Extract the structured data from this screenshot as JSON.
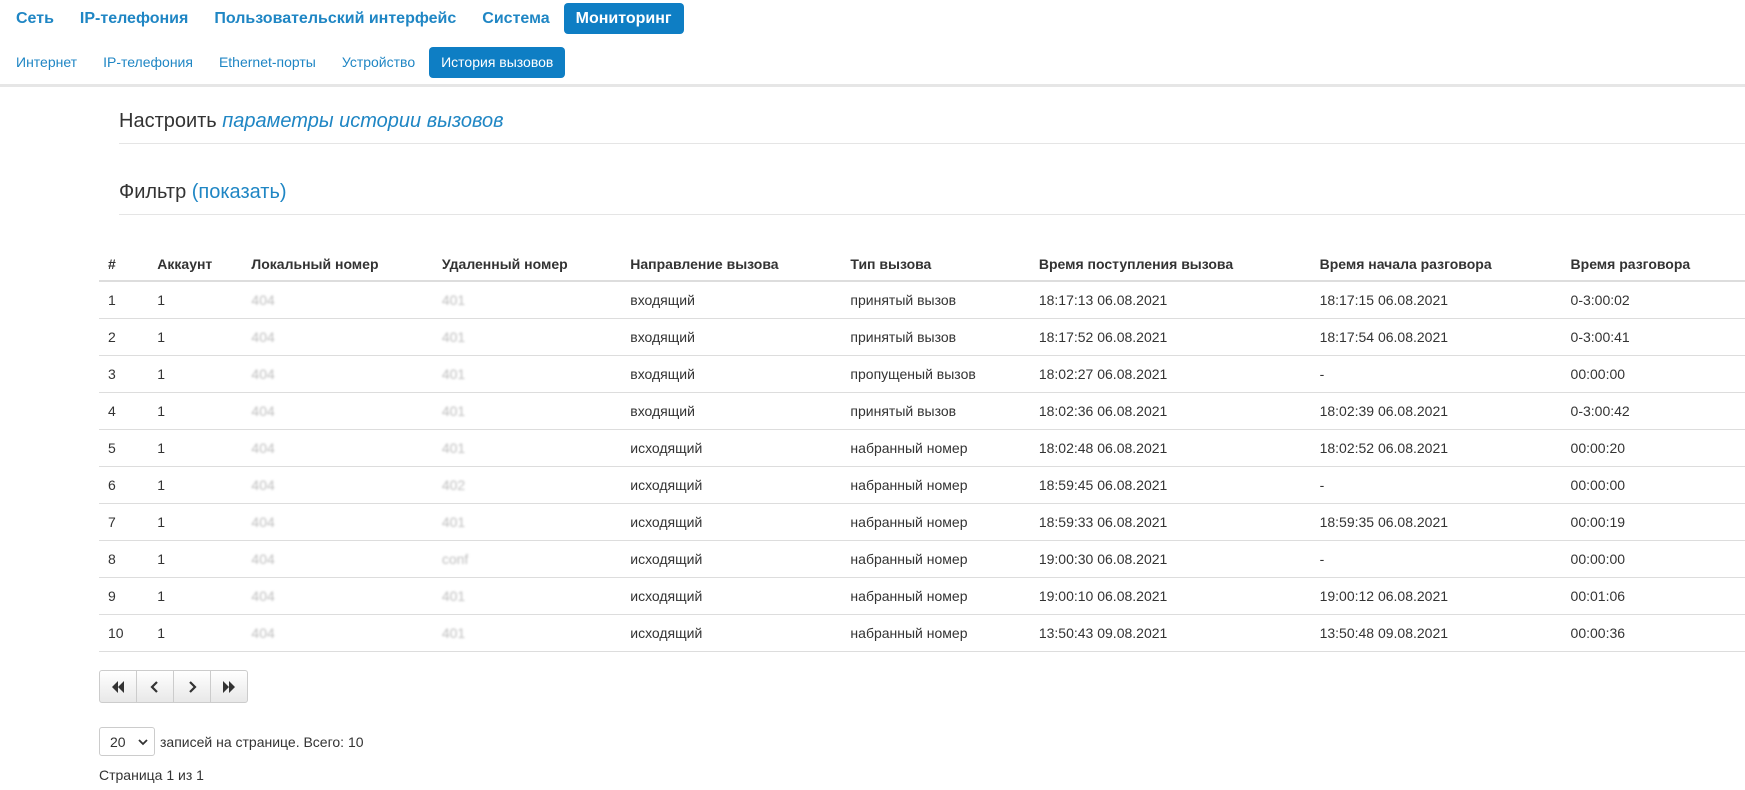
{
  "top_nav": [
    {
      "label": "Сеть",
      "active": false
    },
    {
      "label": "IP-телефония",
      "active": false
    },
    {
      "label": "Пользовательский интерфейс",
      "active": false
    },
    {
      "label": "Система",
      "active": false
    },
    {
      "label": "Мониторинг",
      "active": true
    }
  ],
  "sub_nav": [
    {
      "label": "Интернет",
      "active": false
    },
    {
      "label": "IP-телефония",
      "active": false
    },
    {
      "label": "Ethernet-порты",
      "active": false
    },
    {
      "label": "Устройство",
      "active": false
    },
    {
      "label": "История вызовов",
      "active": true
    }
  ],
  "settings": {
    "prefix": "Настроить ",
    "link": "параметры истории вызовов"
  },
  "filter": {
    "prefix": "Фильтр ",
    "link": "(показать)"
  },
  "table": {
    "headers": [
      "#",
      "Аккаунт",
      "Локальный номер",
      "Удаленный номер",
      "Направление вызова",
      "Тип вызова",
      "Время поступления вызова",
      "Время начала разговора",
      "Время разговора"
    ],
    "rows": [
      [
        "1",
        "1",
        "404",
        "401",
        "входящий",
        "принятый вызов",
        "18:17:13 06.08.2021",
        "18:17:15 06.08.2021",
        "0-3:00:02"
      ],
      [
        "2",
        "1",
        "404",
        "401",
        "входящий",
        "принятый вызов",
        "18:17:52 06.08.2021",
        "18:17:54 06.08.2021",
        "0-3:00:41"
      ],
      [
        "3",
        "1",
        "404",
        "401",
        "входящий",
        "пропущеный вызов",
        "18:02:27 06.08.2021",
        "-",
        "00:00:00"
      ],
      [
        "4",
        "1",
        "404",
        "401",
        "входящий",
        "принятый вызов",
        "18:02:36 06.08.2021",
        "18:02:39 06.08.2021",
        "0-3:00:42"
      ],
      [
        "5",
        "1",
        "404",
        "401",
        "исходящий",
        "набранный номер",
        "18:02:48 06.08.2021",
        "18:02:52 06.08.2021",
        "00:00:20"
      ],
      [
        "6",
        "1",
        "404",
        "402",
        "исходящий",
        "набранный номер",
        "18:59:45 06.08.2021",
        "-",
        "00:00:00"
      ],
      [
        "7",
        "1",
        "404",
        "401",
        "исходящий",
        "набранный номер",
        "18:59:33 06.08.2021",
        "18:59:35 06.08.2021",
        "00:00:19"
      ],
      [
        "8",
        "1",
        "404",
        "conf",
        "исходящий",
        "набранный номер",
        "19:00:30 06.08.2021",
        "-",
        "00:00:00"
      ],
      [
        "9",
        "1",
        "404",
        "401",
        "исходящий",
        "набранный номер",
        "19:00:10 06.08.2021",
        "19:00:12 06.08.2021",
        "00:01:06"
      ],
      [
        "10",
        "1",
        "404",
        "401",
        "исходящий",
        "набранный номер",
        "13:50:43 09.08.2021",
        "13:50:48 09.08.2021",
        "00:00:36"
      ]
    ]
  },
  "pagination": {
    "buttons": [
      {
        "name": "first-page-icon"
      },
      {
        "name": "prev-page-icon"
      },
      {
        "name": "next-page-icon"
      },
      {
        "name": "last-page-icon"
      }
    ]
  },
  "per_page": {
    "value": "20",
    "text": "записей на странице. Всего: 10"
  },
  "page_info": "Страница 1 из 1",
  "colors": {
    "accent": "#0e7ec4",
    "link": "#1f86c4",
    "text": "#333333"
  }
}
